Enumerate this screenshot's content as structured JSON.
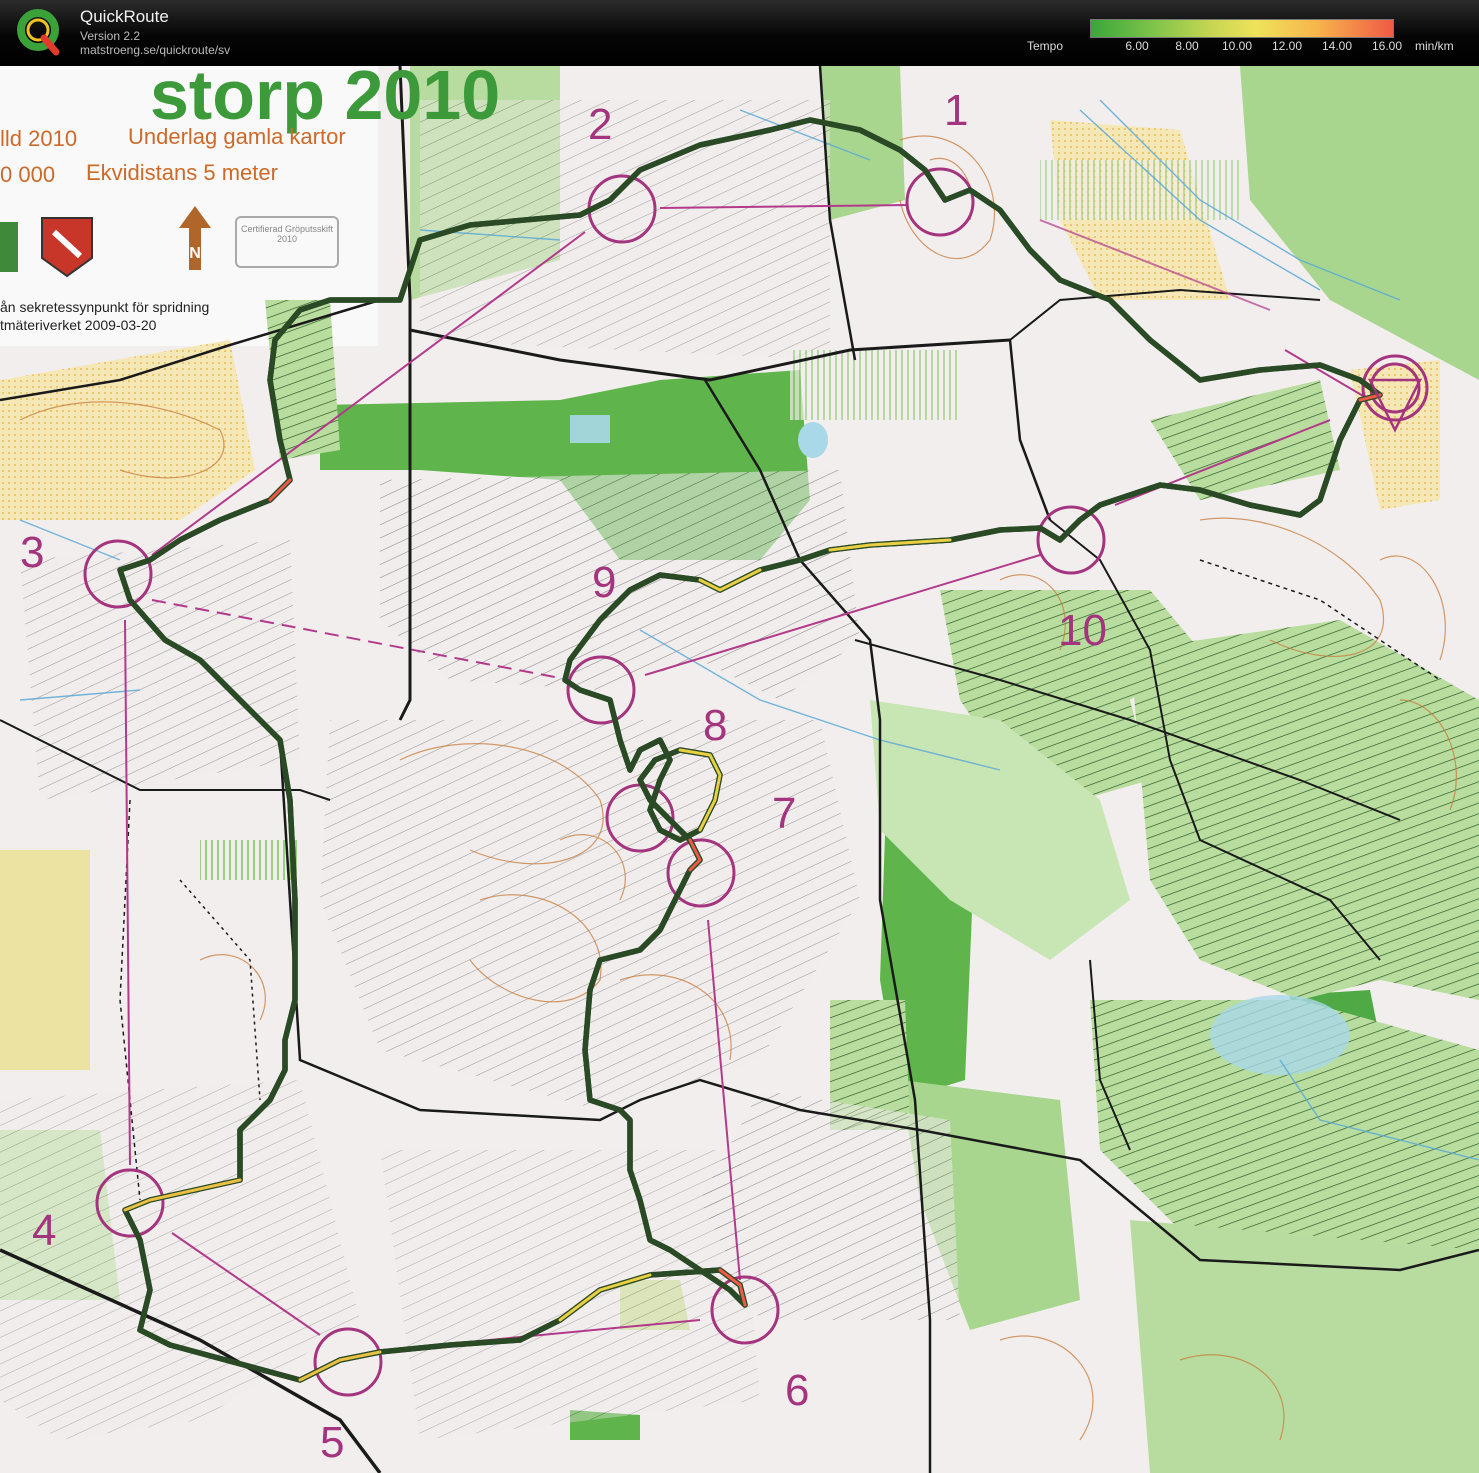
{
  "app": {
    "name": "QuickRoute",
    "version": "Version 2.2",
    "url": "matstroeng.se/quickroute/sv"
  },
  "legend": {
    "label": "Tempo",
    "ticks": [
      "6.00",
      "8.00",
      "10.00",
      "12.00",
      "14.00",
      "16.00"
    ],
    "unit": "min/km"
  },
  "map_text": {
    "title": "storp 2010",
    "line1a": "lld 2010",
    "line1b": "Underlag gamla kartor",
    "line2a": "0 000",
    "line2b": "Ekvidistans 5 meter",
    "line3": "ån sekretessynpunkt för spridning",
    "line4": "tmäteriverket 2009-03-20",
    "cert": "Certifierad Gröputsskift 2010"
  },
  "controls": [
    {
      "num": "1"
    },
    {
      "num": "2"
    },
    {
      "num": "3"
    },
    {
      "num": "4"
    },
    {
      "num": "5"
    },
    {
      "num": "6"
    },
    {
      "num": "7"
    },
    {
      "num": "8"
    },
    {
      "num": "9"
    },
    {
      "num": "10"
    }
  ],
  "colors": {
    "course": "#b23a8a",
    "route": "#5aa63c",
    "forest_green": "#5fb54c",
    "light_green": "#a9d68f",
    "yellow": "#f2d98a",
    "contour": "#c77b3a"
  }
}
